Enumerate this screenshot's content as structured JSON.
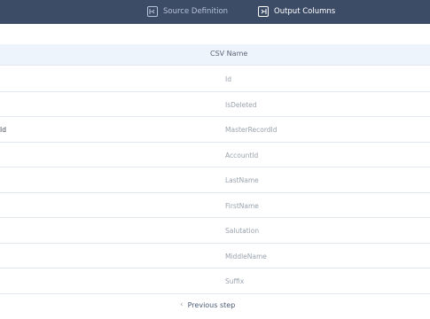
{
  "tabs": {
    "source_label": "Source Definition",
    "output_label": "Output Columns"
  },
  "table": {
    "header": "CSV Name",
    "rows": [
      {
        "left": "",
        "csv": "Id"
      },
      {
        "left": "",
        "csv": "IsDeleted"
      },
      {
        "left": "Id",
        "csv": "MasterRecordId"
      },
      {
        "left": "",
        "csv": "AccountId"
      },
      {
        "left": "",
        "csv": "LastName"
      },
      {
        "left": "",
        "csv": "FirstName"
      },
      {
        "left": "",
        "csv": "Salutation"
      },
      {
        "left": "",
        "csv": "MiddleName"
      },
      {
        "left": "",
        "csv": "Suffix"
      }
    ]
  },
  "footer": {
    "previous_label": "Previous step"
  },
  "colors": {
    "topbar": "#3d4c66",
    "header_bg": "#eef4fb"
  }
}
